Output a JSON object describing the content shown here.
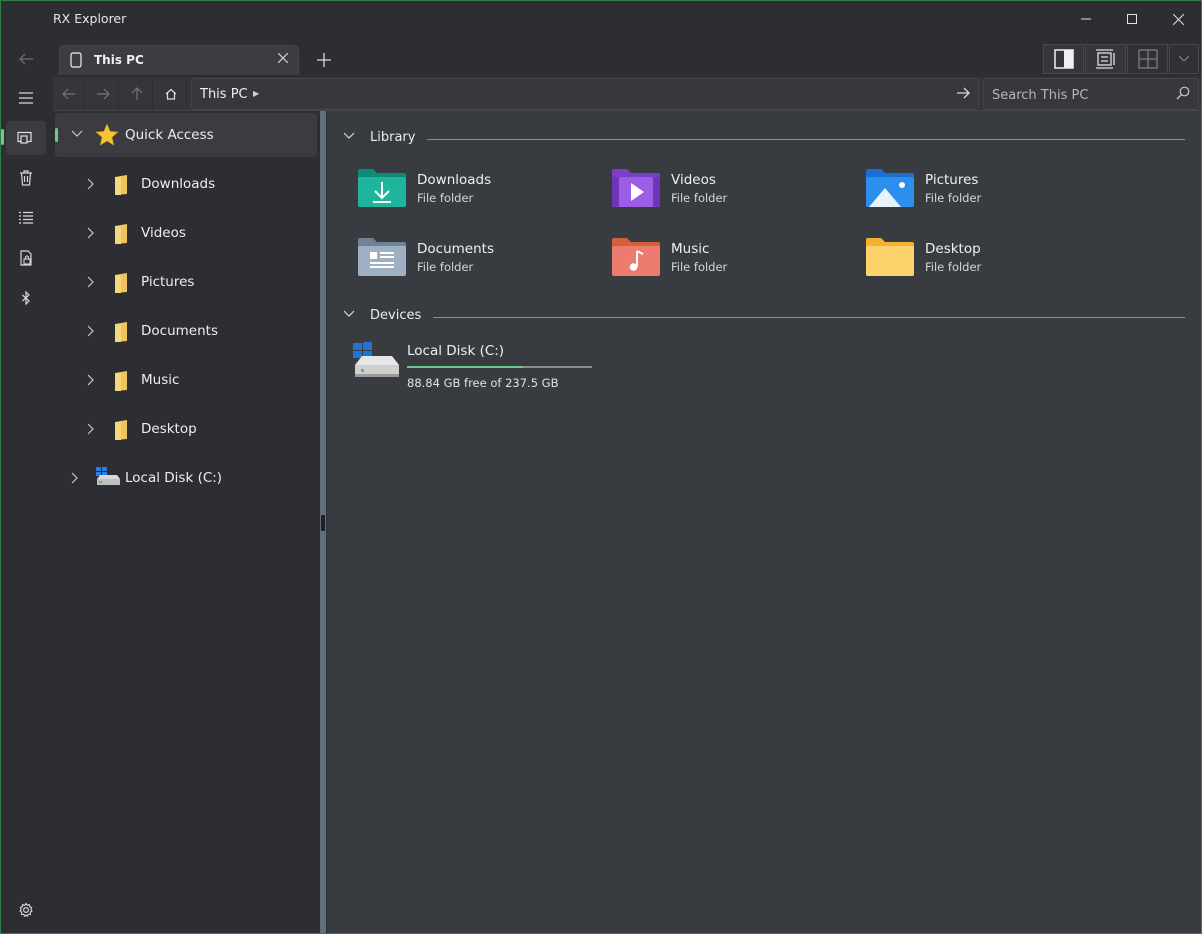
{
  "window": {
    "title": "RX Explorer",
    "accent_color": "#6ccb8a",
    "border_color": "#2f7f45"
  },
  "tabs": [
    {
      "label": "This PC",
      "active": true
    }
  ],
  "navbar": {
    "address_segments": [
      "This PC"
    ],
    "search_placeholder": "Search This PC"
  },
  "rail": {
    "icons": [
      "back-icon",
      "menu-icon",
      "this-pc-icon",
      "recycle-bin-icon",
      "task-list-icon",
      "secure-area-icon",
      "bluetooth-icon",
      "settings-icon"
    ]
  },
  "tree": {
    "quick_access": "Quick Access",
    "children": [
      "Downloads",
      "Videos",
      "Pictures",
      "Documents",
      "Music",
      "Desktop"
    ],
    "drive": "Local Disk (C:)"
  },
  "main": {
    "library_title": "Library",
    "devices_title": "Devices",
    "library": [
      {
        "name": "Downloads",
        "type": "File folder",
        "icon": "downloads-folder-icon"
      },
      {
        "name": "Videos",
        "type": "File folder",
        "icon": "videos-folder-icon"
      },
      {
        "name": "Pictures",
        "type": "File folder",
        "icon": "pictures-folder-icon"
      },
      {
        "name": "Documents",
        "type": "File folder",
        "icon": "documents-folder-icon"
      },
      {
        "name": "Music",
        "type": "File folder",
        "icon": "music-folder-icon"
      },
      {
        "name": "Desktop",
        "type": "File folder",
        "icon": "desktop-folder-icon"
      }
    ],
    "devices": [
      {
        "name": "Local Disk (C:)",
        "free_text": "88.84 GB free of 237.5 GB",
        "used_fraction": 0.626
      }
    ]
  }
}
